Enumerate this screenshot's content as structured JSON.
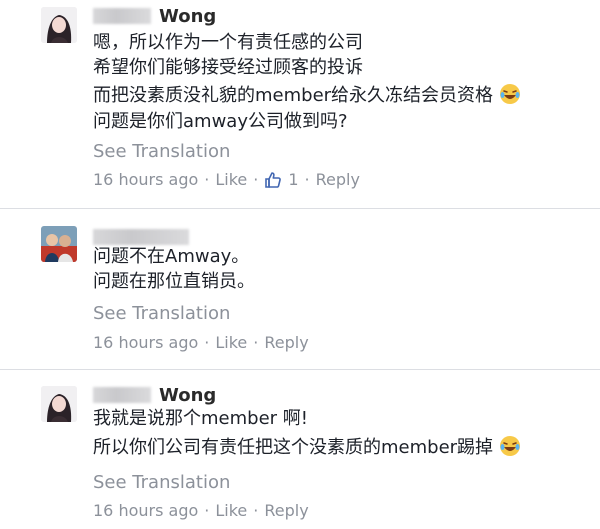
{
  "comments": [
    {
      "author": "Wong",
      "lines": [
        "嗯，所以作为一个有责任感的公司",
        "希望你们能够接受经过顾客的投诉",
        "而把没素质没礼貌的member给永久冻结会员资格",
        "问题是你们amway公司做到吗?"
      ],
      "see_translation": "See Translation",
      "time": "16 hours ago",
      "like": "Like",
      "like_count": "1",
      "reply": "Reply",
      "dot": "·"
    },
    {
      "author": "",
      "lines": [
        "问题不在Amway。",
        "问题在那位直销员。"
      ],
      "see_translation": "See Translation",
      "time": "16 hours ago",
      "like": "Like",
      "reply": "Reply",
      "dot": "·"
    },
    {
      "author": "Wong",
      "lines": [
        "我就是说那个member 啊!",
        "所以你们公司有责任把这个没素质的member踢掉"
      ],
      "see_translation": "See Translation",
      "time": "16 hours ago",
      "like": "Like",
      "reply": "Reply",
      "dot": "·"
    }
  ],
  "colors": {
    "text": "#1d2129",
    "meta": "#8c919a",
    "divider": "#dcdee3",
    "like_icon": "#4267b2"
  }
}
